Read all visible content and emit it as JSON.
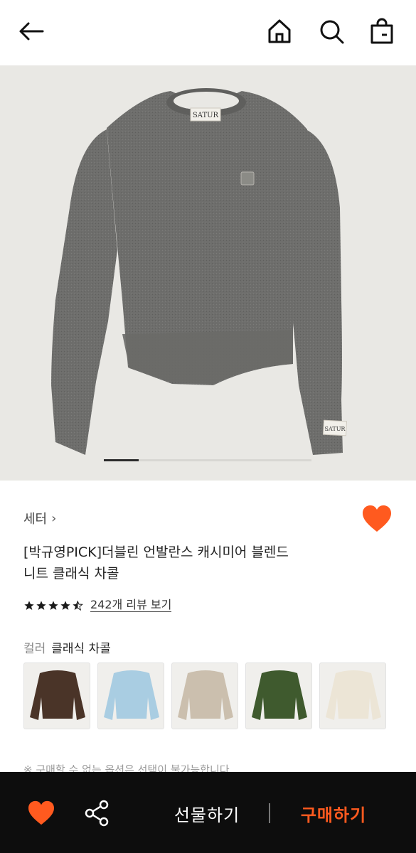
{
  "header": {
    "back_icon": "arrow-left-icon",
    "home_icon": "home-icon",
    "search_icon": "search-icon",
    "bag_icon": "shopping-bag-icon"
  },
  "gallery": {
    "image_description": "product-photo",
    "label_text": "SATUR",
    "current_slide_fraction": 0.167
  },
  "product": {
    "category": "세터",
    "category_chevron": "›",
    "title_line1": "[박규영PICK]더블린 언발란스 캐시미어 블렌드",
    "title_line2": "니트 클래식 차콜",
    "rating": 4.5,
    "rating_max": 5,
    "review_link": "242개 리뷰 보기",
    "wishlisted": true,
    "color_label": "컬러",
    "color_value": "클래식 차콜",
    "swatches": [
      {
        "name": "brown",
        "color": "#4a3428"
      },
      {
        "name": "sky-blue",
        "color": "#a9cde2"
      },
      {
        "name": "beige",
        "color": "#cbbfae"
      },
      {
        "name": "green",
        "color": "#3f5a2e"
      },
      {
        "name": "cream",
        "color": "#ece5d6"
      }
    ],
    "notice": "※ 구매할 수 없는 옵션은 선택이 불가능합니다."
  },
  "bottom_bar": {
    "gift_label": "선물하기",
    "buy_label": "구매하기",
    "accent_color": "#ff5a1f",
    "heart_icon": "heart-icon",
    "share_icon": "share-icon"
  }
}
